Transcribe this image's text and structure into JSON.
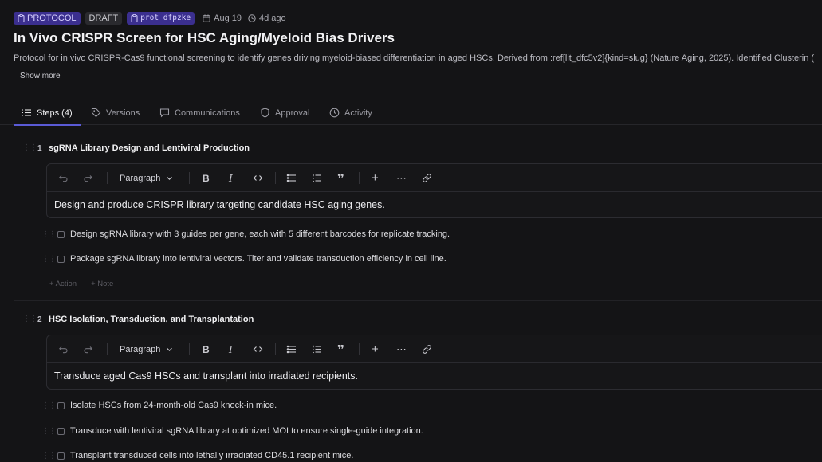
{
  "header": {
    "badges": {
      "type": "PROTOCOL",
      "status": "DRAFT",
      "id": "prot_dfpzke"
    },
    "date": "Aug 19",
    "relative_time": "4d ago",
    "title": "In Vivo CRISPR Screen for HSC Aging/Myeloid Bias Drivers",
    "description": "Protocol for in vivo CRISPR-Cas9 functional screening to identify genes driving myeloid-biased differentiation in aged HSCs. Derived from :ref[lit_dfc5v2]{kind=slug} (Nature Aging, 2025). Identified Clusterin (",
    "show_more": "Show more"
  },
  "tabs": [
    {
      "label": "Steps (4)",
      "icon": "list-icon",
      "active": true
    },
    {
      "label": "Versions",
      "icon": "tag-icon",
      "active": false
    },
    {
      "label": "Communications",
      "icon": "message-icon",
      "active": false
    },
    {
      "label": "Approval",
      "icon": "shield-icon",
      "active": false
    },
    {
      "label": "Activity",
      "icon": "clock-icon",
      "active": false
    }
  ],
  "toolbar": {
    "block_type": "Paragraph"
  },
  "steps": [
    {
      "number": "1",
      "title": "sgRNA Library Design and Lentiviral Production",
      "summary": "Design and produce CRISPR library targeting candidate HSC aging genes.",
      "actions": [
        "Design sgRNA library with 3 guides per gene, each with 5 different barcodes for replicate tracking.",
        "Package sgRNA library into lentiviral vectors. Titer and validate transduction efficiency in cell line."
      ],
      "add_action": "+ Action",
      "add_note": "+ Note"
    },
    {
      "number": "2",
      "title": "HSC Isolation, Transduction, and Transplantation",
      "summary": "Transduce aged Cas9 HSCs and transplant into irradiated recipients.",
      "actions": [
        "Isolate HSCs from 24-month-old Cas9 knock-in mice.",
        "Transduce with lentiviral sgRNA library at optimized MOI to ensure single-guide integration.",
        "Transplant transduced cells into lethally irradiated CD45.1 recipient mice."
      ]
    }
  ],
  "colors": {
    "accent": "#5b5bd6",
    "background": "#141416",
    "badge_bg": "#3b2f8f"
  }
}
